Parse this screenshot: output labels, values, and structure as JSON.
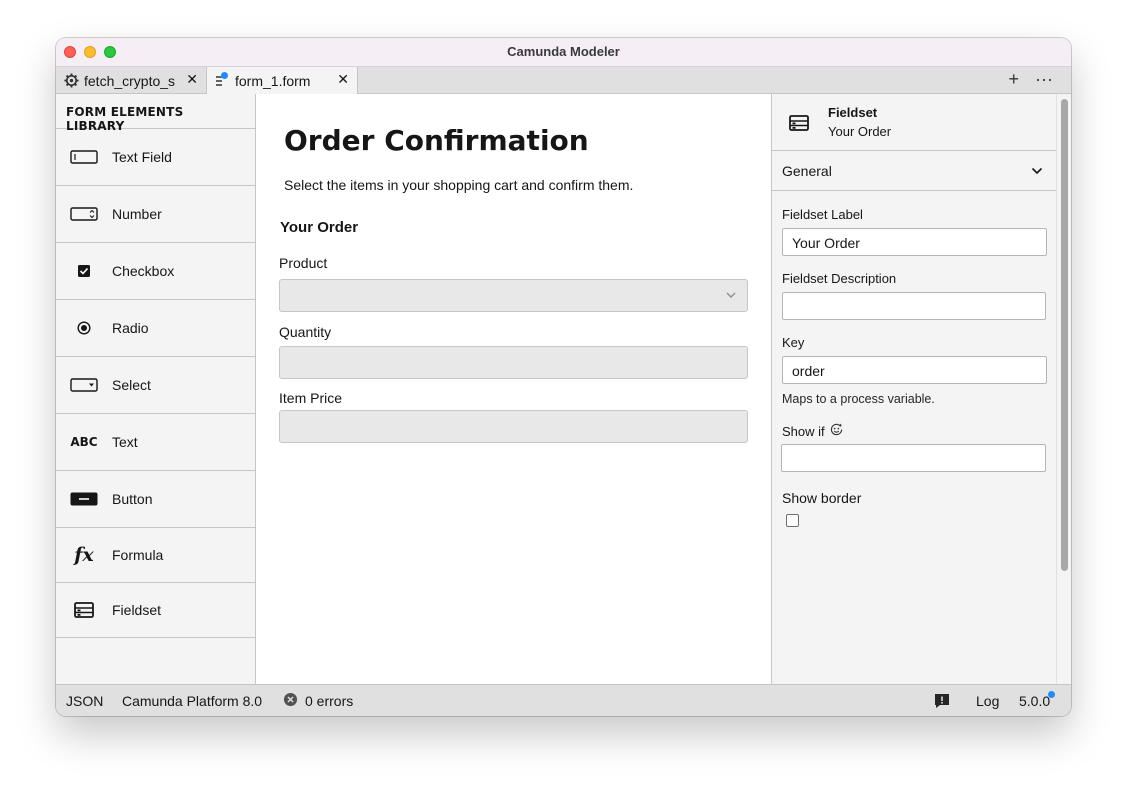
{
  "window": {
    "title": "Camunda Modeler"
  },
  "tabs": [
    {
      "label": "fetch_crypto_s",
      "icon": "gear-icon",
      "close": "✕"
    },
    {
      "label": "form_1.form",
      "icon": "form-icon",
      "close": "✕",
      "unsaved": true
    }
  ],
  "tabbar_actions": {
    "add": "+",
    "more": "···"
  },
  "library": {
    "title": "FORM ELEMENTS LIBRARY",
    "items": [
      {
        "label": "Text Field",
        "icon": "textfield-icon"
      },
      {
        "label": "Number",
        "icon": "number-icon"
      },
      {
        "label": "Checkbox",
        "icon": "checkbox-icon"
      },
      {
        "label": "Radio",
        "icon": "radio-icon"
      },
      {
        "label": "Select",
        "icon": "select-icon"
      },
      {
        "label": "Text",
        "icon": "text-icon",
        "glyph": "ABC"
      },
      {
        "label": "Button",
        "icon": "button-icon"
      },
      {
        "label": "Formula",
        "icon": "formula-icon",
        "glyph": "fx"
      },
      {
        "label": "Fieldset",
        "icon": "fieldset-icon"
      }
    ]
  },
  "form": {
    "title": "Order Confirmation",
    "description": "Select the items in your shopping cart and confirm them.",
    "fieldset_label": "Your Order",
    "fields": [
      {
        "label": "Product",
        "type": "select"
      },
      {
        "label": "Quantity",
        "type": "number"
      },
      {
        "label": "Item Price",
        "type": "number"
      }
    ]
  },
  "properties": {
    "type": "Fieldset",
    "subtitle": "Your Order",
    "group": "General",
    "fieldset_label_title": "Fieldset Label",
    "fieldset_label_value": "Your Order",
    "fieldset_description_title": "Fieldset Description",
    "fieldset_description_value": "",
    "key_title": "Key",
    "key_value": "order",
    "key_hint": "Maps to a process variable.",
    "show_if_title": "Show if",
    "show_if_value": "",
    "show_border_title": "Show border",
    "show_border_checked": false
  },
  "statusbar": {
    "format": "JSON",
    "platform": "Camunda Platform 8.0",
    "errors": "0 errors",
    "log": "Log",
    "version": "5.0.0"
  },
  "colors": {
    "accent_blue": "#1f8bff",
    "status_bg": "#e0e0e0"
  }
}
